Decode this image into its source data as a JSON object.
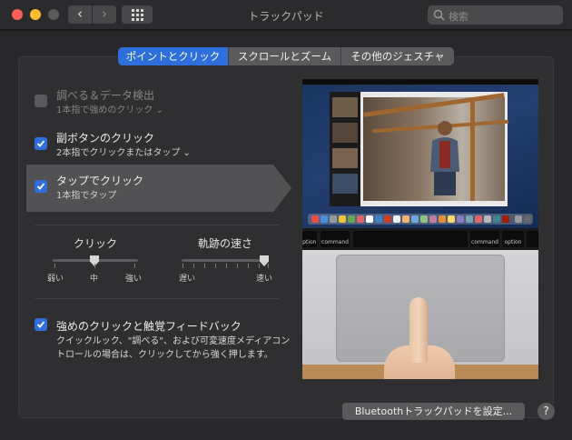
{
  "window": {
    "title": "トラックパッド"
  },
  "toolbar": {
    "back_label": "‹",
    "forward_label": "›"
  },
  "search": {
    "placeholder": "検索"
  },
  "tabs": [
    {
      "label": "ポイントとクリック",
      "active": true
    },
    {
      "label": "スクロールとズーム",
      "active": false
    },
    {
      "label": "その他のジェスチャ",
      "active": false
    }
  ],
  "options": [
    {
      "title": "調べる＆データ検出",
      "subtitle": "1本指で強めのクリック ⌄",
      "checked": false,
      "enabled": false
    },
    {
      "title": "副ボタンのクリック",
      "subtitle": "2本指でクリックまたはタップ ⌄",
      "checked": true,
      "enabled": true
    },
    {
      "title": "タップでクリック",
      "subtitle": "1本指でタップ",
      "checked": true,
      "enabled": true,
      "selected": true
    }
  ],
  "sliders": {
    "click": {
      "title": "クリック",
      "labels": [
        "弱い",
        "中",
        "強い"
      ],
      "value": "中",
      "level": 0.5
    },
    "tracking": {
      "title": "軌跡の速さ",
      "labels": [
        "遅い",
        "速い"
      ],
      "level": 1.0
    }
  },
  "force_click": {
    "title": "強めのクリックと触覚フィードバック",
    "checked": true,
    "description": "クイックルック、\"調べる\"、および可変速度メディアコントロールの場合は、クリックしてから強く押します。"
  },
  "preview": {
    "keys": [
      "option",
      "command",
      "command",
      "option"
    ]
  },
  "footer": {
    "bluetooth_button": "Bluetoothトラックパッドを設定...",
    "help_label": "?"
  },
  "colors": {
    "accent": "#2f6fdb",
    "panel": "#2f2f31",
    "window": "#28282a"
  }
}
